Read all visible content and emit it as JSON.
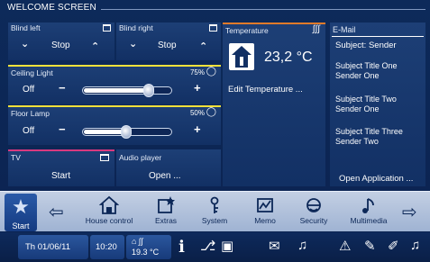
{
  "screen_title": "WELCOME SCREEN",
  "blinds": [
    {
      "name": "Blind left",
      "stop_label": "Stop"
    },
    {
      "name": "Blind right",
      "stop_label": "Stop"
    }
  ],
  "lights": [
    {
      "name": "Ceiling Light",
      "percent_label": "75%",
      "level": 0.75,
      "off_label": "Off",
      "minus": "−",
      "plus": "+"
    },
    {
      "name": "Floor Lamp",
      "percent_label": "50%",
      "level": 0.5,
      "off_label": "Off",
      "minus": "−",
      "plus": "+"
    }
  ],
  "tv": {
    "name": "TV",
    "action": "Start"
  },
  "audio": {
    "name": "Audio player",
    "action": "Open ..."
  },
  "temperature": {
    "title": "Temperature",
    "value": "23,2 °C",
    "edit_label": "Edit Temperature ..."
  },
  "email": {
    "title": "E-Mail",
    "header": "Subject: Sender",
    "messages": [
      {
        "subject": "Subject Title One",
        "sender": "Sender One"
      },
      {
        "subject": "Subject Title Two",
        "sender": "Sender One"
      },
      {
        "subject": "Subject Title Three",
        "sender": "Sender Two"
      }
    ],
    "open_label": "Open Application ..."
  },
  "nav": {
    "start": "Start",
    "items": [
      {
        "label": "House control",
        "icon": "house-icon"
      },
      {
        "label": "Extras",
        "icon": "extras-icon"
      },
      {
        "label": "System",
        "icon": "system-icon"
      },
      {
        "label": "Memo",
        "icon": "memo-icon"
      },
      {
        "label": "Security",
        "icon": "security-icon"
      },
      {
        "label": "Multimedia",
        "icon": "multimedia-icon"
      }
    ]
  },
  "status": {
    "date": "Th 01/06/11",
    "time": "10:20",
    "temp": "19.3 °C"
  },
  "colors": {
    "accent_yellow": "#f5e13a",
    "tv_pink": "#d9397f",
    "temp_orange": "#e07a2a",
    "panel": "#123064"
  }
}
